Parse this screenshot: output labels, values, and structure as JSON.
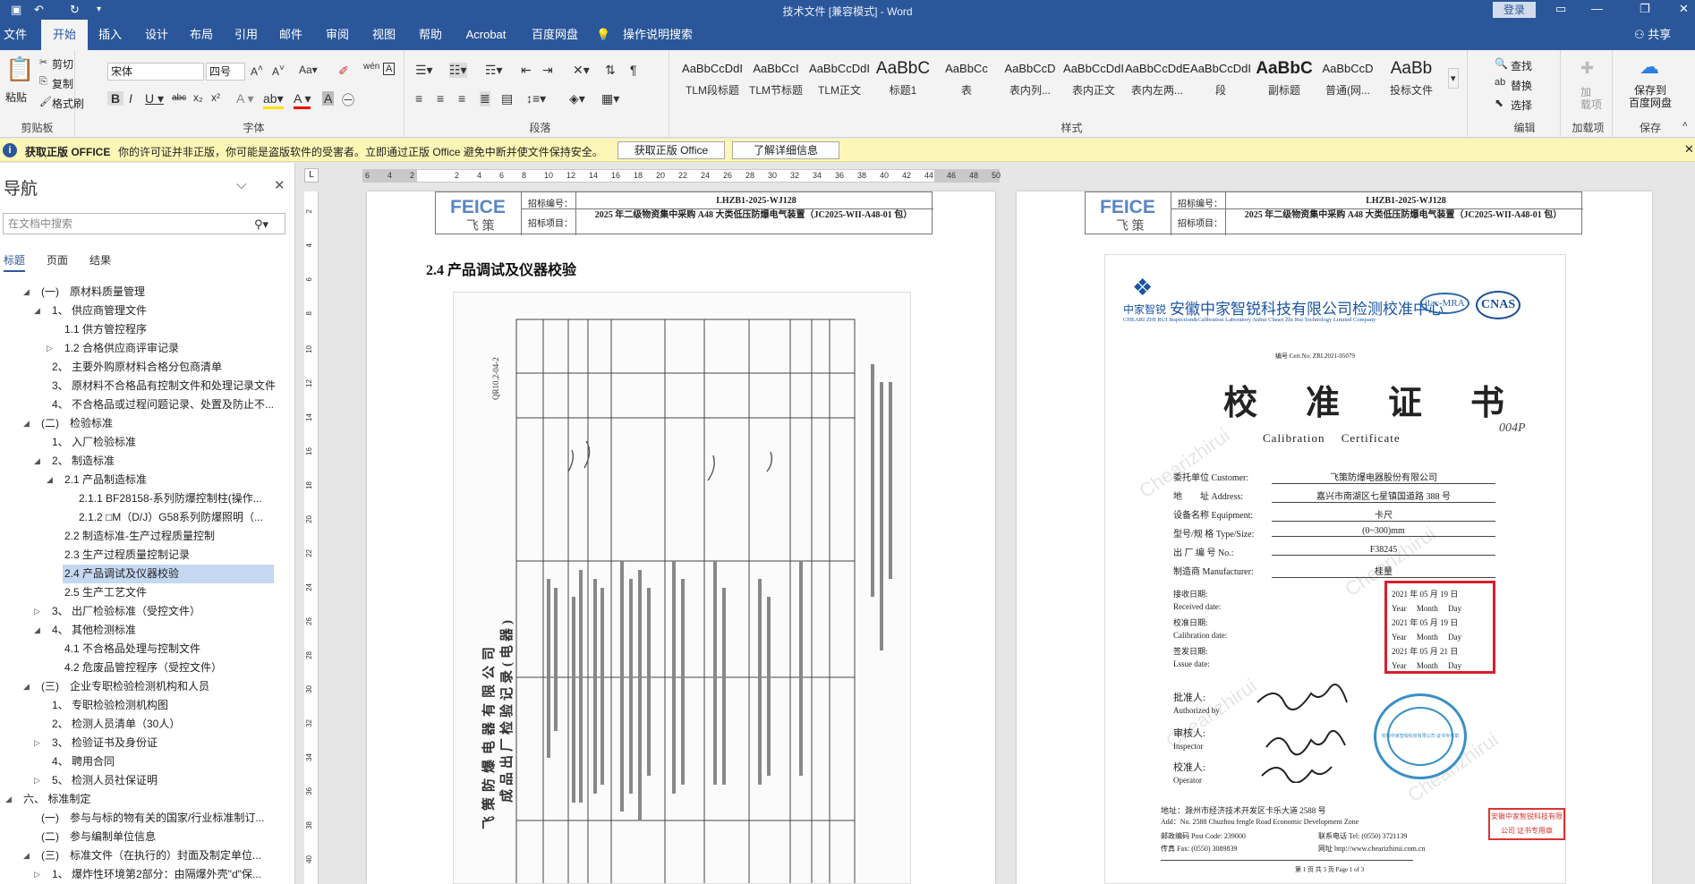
{
  "titlebar": {
    "title": "技术文件 [兼容模式] - Word",
    "login": "登录",
    "autosave_icon": "save-icon",
    "undo_icon": "undo-icon",
    "redo_icon": "redo-icon"
  },
  "tabs": [
    "文件",
    "开始",
    "插入",
    "设计",
    "布局",
    "引用",
    "邮件",
    "审阅",
    "视图",
    "帮助",
    "Acrobat",
    "百度网盘",
    "操作说明搜索"
  ],
  "share": "共享",
  "ribbon": {
    "clipboard": {
      "paste": "粘贴",
      "cut": "剪切",
      "copy": "复制",
      "format_painter": "格式刷",
      "label": "剪贴板"
    },
    "font": {
      "name": "宋体",
      "size": "四号",
      "label": "字体"
    },
    "paragraph": {
      "label": "段落"
    },
    "styles": {
      "label": "样式",
      "items": [
        {
          "preview": "AaBbCcDdI",
          "name": "TLM段标题"
        },
        {
          "preview": "AaBbCcI",
          "name": "TLM节标题"
        },
        {
          "preview": "AaBbCcDdI",
          "name": "TLM正文"
        },
        {
          "preview": "AaBbC",
          "name": "标题1"
        },
        {
          "preview": "AaBbCc",
          "name": "表"
        },
        {
          "preview": "AaBbCcD",
          "name": "表内列..."
        },
        {
          "preview": "AaBbCcDdI",
          "name": "表内正文"
        },
        {
          "preview": "AaBbCcDdEe",
          "name": "表内左两..."
        },
        {
          "preview": "AaBbCcDdI",
          "name": "段"
        },
        {
          "preview": "AaBbC",
          "name": "副标题"
        },
        {
          "preview": "AaBbCcD",
          "name": "普通(网..."
        },
        {
          "preview": "AaBb",
          "name": "投标文件"
        }
      ]
    },
    "editing": {
      "find": "查找",
      "replace": "替换",
      "select": "选择",
      "label": "编辑"
    },
    "addins": {
      "add": "加\n载项",
      "label": "加载项"
    },
    "save": {
      "btn": "保存到\n百度网盘",
      "label": "保存"
    }
  },
  "message_bar": {
    "title": "获取正版 OFFICE",
    "text": "你的许可证并非正版，你可能是盗版软件的受害者。立即通过正版 Office 避免中断并使文件保持安全。",
    "btn1": "获取正版 Office",
    "btn2": "了解详细信息"
  },
  "nav": {
    "title": "导航",
    "search_placeholder": "在文档中搜索",
    "tabs": [
      "标题",
      "页面",
      "结果"
    ],
    "items": [
      {
        "text": "(一)　原材料质量管理",
        "level": 1,
        "tw": "◢"
      },
      {
        "text": "1、 供应商管理文件",
        "level": 2,
        "tw": "◢"
      },
      {
        "text": "1.1  供方管控程序",
        "level": 3,
        "tw": ""
      },
      {
        "text": "1.2  合格供应商评审记录",
        "level": 3,
        "tw": "▷"
      },
      {
        "text": "2、 主要外购原材料合格分包商清单",
        "level": 2,
        "tw": ""
      },
      {
        "text": "3、 原材料不合格品有控制文件和处理记录文件",
        "level": 2,
        "tw": ""
      },
      {
        "text": "4、 不合格品或过程问题记录、处置及防止不...",
        "level": 2,
        "tw": ""
      },
      {
        "text": "(二)　检验标准",
        "level": 1,
        "tw": "◢"
      },
      {
        "text": "1、 入厂检验标准",
        "level": 2,
        "tw": ""
      },
      {
        "text": "2、 制造标准",
        "level": 2,
        "tw": "◢"
      },
      {
        "text": "2.1  产品制造标准",
        "level": 3,
        "tw": "◢"
      },
      {
        "text": "2.1.1  BF28158-系列防爆控制柱(操作...",
        "level": 4,
        "tw": ""
      },
      {
        "text": "2.1.2  □M（D/J）G58系列防爆照明（...",
        "level": 4,
        "tw": ""
      },
      {
        "text": "2.2  制造标准-生产过程质量控制",
        "level": 3,
        "tw": ""
      },
      {
        "text": "2.3  生产过程质量控制记录",
        "level": 3,
        "tw": ""
      },
      {
        "text": "2.4  产品调试及仪器校验",
        "level": 3,
        "tw": "",
        "selected": true
      },
      {
        "text": "2.5  生产工艺文件",
        "level": 3,
        "tw": ""
      },
      {
        "text": "3、 出厂检验标准（受控文件）",
        "level": 2,
        "tw": "▷"
      },
      {
        "text": "4、 其他检测标准",
        "level": 2,
        "tw": "◢"
      },
      {
        "text": "4.1  不合格品处理与控制文件",
        "level": 3,
        "tw": ""
      },
      {
        "text": "4.2  危废品管控程序（受控文件）",
        "level": 3,
        "tw": ""
      },
      {
        "text": "(三)　企业专职检验检测机构和人员",
        "level": 1,
        "tw": "◢"
      },
      {
        "text": "1、 专职检验检测机构图",
        "level": 2,
        "tw": ""
      },
      {
        "text": "2、 检测人员清单（30人）",
        "level": 2,
        "tw": ""
      },
      {
        "text": "3、 检验证书及身份证",
        "level": 2,
        "tw": "▷"
      },
      {
        "text": "4、 聘用合同",
        "level": 2,
        "tw": ""
      },
      {
        "text": "5、 检测人员社保证明",
        "level": 2,
        "tw": "▷"
      },
      {
        "text": "六、 标准制定",
        "level": 0,
        "tw": "◢"
      },
      {
        "text": "(一)　参与与标的物有关的国家/行业标准制订...",
        "level": 1,
        "tw": ""
      },
      {
        "text": "(二)　参与编制单位信息",
        "level": 1,
        "tw": ""
      },
      {
        "text": "(三)　标准文件（在执行的）封面及制定单位...",
        "level": 1,
        "tw": "◢"
      },
      {
        "text": "1、 爆炸性环境第2部分：由隔爆外壳\"d\"保...",
        "level": 2,
        "tw": "▷"
      }
    ]
  },
  "ruler": {
    "ticks": [
      "6",
      "4",
      "2",
      "",
      "2",
      "4",
      "6",
      "8",
      "10",
      "12",
      "14",
      "16",
      "18",
      "20",
      "22",
      "24",
      "26",
      "28",
      "30",
      "32",
      "34",
      "36",
      "38",
      "40",
      "42",
      "44",
      "46",
      "48",
      "50"
    ],
    "vticks": [
      "2",
      "4",
      "6",
      "8",
      "10",
      "12",
      "14",
      "16",
      "18",
      "20",
      "22",
      "24",
      "26",
      "28",
      "30",
      "32",
      "34",
      "36",
      "38",
      "40"
    ]
  },
  "page_header": {
    "logo_big": "FEICE",
    "logo_small": "飞 策",
    "bid_no_label": "招标编号：",
    "bid_no": "LHZB1-2025-WJ128",
    "bid_item_label": "招标项目：",
    "bid_item": "2025 年二级物资集中采购 A48 大类低压防爆电气装置（JC2025-WII-A48-01 包）"
  },
  "page1": {
    "heading": "2.4  产品调试及仪器校验",
    "scan_title": "飞策防爆电器有限公司",
    "scan_subtitle": "成品出厂检验记录(电器)",
    "scan_code": "QR10.2-04-2"
  },
  "cert": {
    "company_cn": "安徽中家智锐科技有限公司检测校准中心",
    "company_en": "CHEARI ZHI RUI  Inspection&Calibration Laboratory Anhui Cheari Zhi Rui Technology Limited Company",
    "brand": "中家智锐",
    "cert_no": "编号 Cert.No: ZRL2021-05079",
    "title": "校　准　证　书",
    "title_en": "Calibration　 Certificate",
    "handwritten": "004P",
    "rows": [
      {
        "label": "委托单位 Customer:",
        "value": "飞策防爆电器股份有限公司"
      },
      {
        "label": "地　　址 Address:",
        "value": "嘉兴市南湖区七星镇国道路 388 号"
      },
      {
        "label": "设备名称 Equipment:",
        "value": "卡尺"
      },
      {
        "label": "型号/规 格 Type/Size:",
        "value": "(0~300)mm"
      },
      {
        "label": "出 厂 编 号 No.:",
        "value": "F38245"
      },
      {
        "label": "制造商 Manufacturer:",
        "value": "桂量"
      }
    ],
    "dates": [
      {
        "label": "接收日期:",
        "value": "2021 年 05 月 19 日"
      },
      {
        "label": "Received date:",
        "value": "Year　 Month　 Day"
      },
      {
        "label": "校准日期:",
        "value": "2021 年 05 月 19 日"
      },
      {
        "label": "Calibration date:",
        "value": "Year　 Month　 Day"
      },
      {
        "label": "签发日期:",
        "value": "2021 年 05 月 21 日"
      },
      {
        "label": "Lssue date:",
        "value": "Year　 Month　 Day"
      }
    ],
    "approver": "批准人:",
    "approver_en": "Authorized by",
    "inspector": "审核人:",
    "inspector_en": "Inspector",
    "operator": "校准人:",
    "operator_en": "Operator",
    "address": "地址：滁州市经济技术开发区卡乐大道 2588 号",
    "address_en": "Add：No. 2588 Chuzhou fengle Road Economic Development Zone",
    "postcode": "邮政编码 Post Code: 239000",
    "tel": "联系电话 Tel: (0550) 3721139",
    "fax": "传真 Fax: (0550) 3089839",
    "web": "网址 http://www.chearizhirui.com.cn",
    "page_of": "第 1 页 共 3 页 Page 1 of 3",
    "stamp_text": "安徽中家智锐科技有限公司 证书专用章"
  }
}
